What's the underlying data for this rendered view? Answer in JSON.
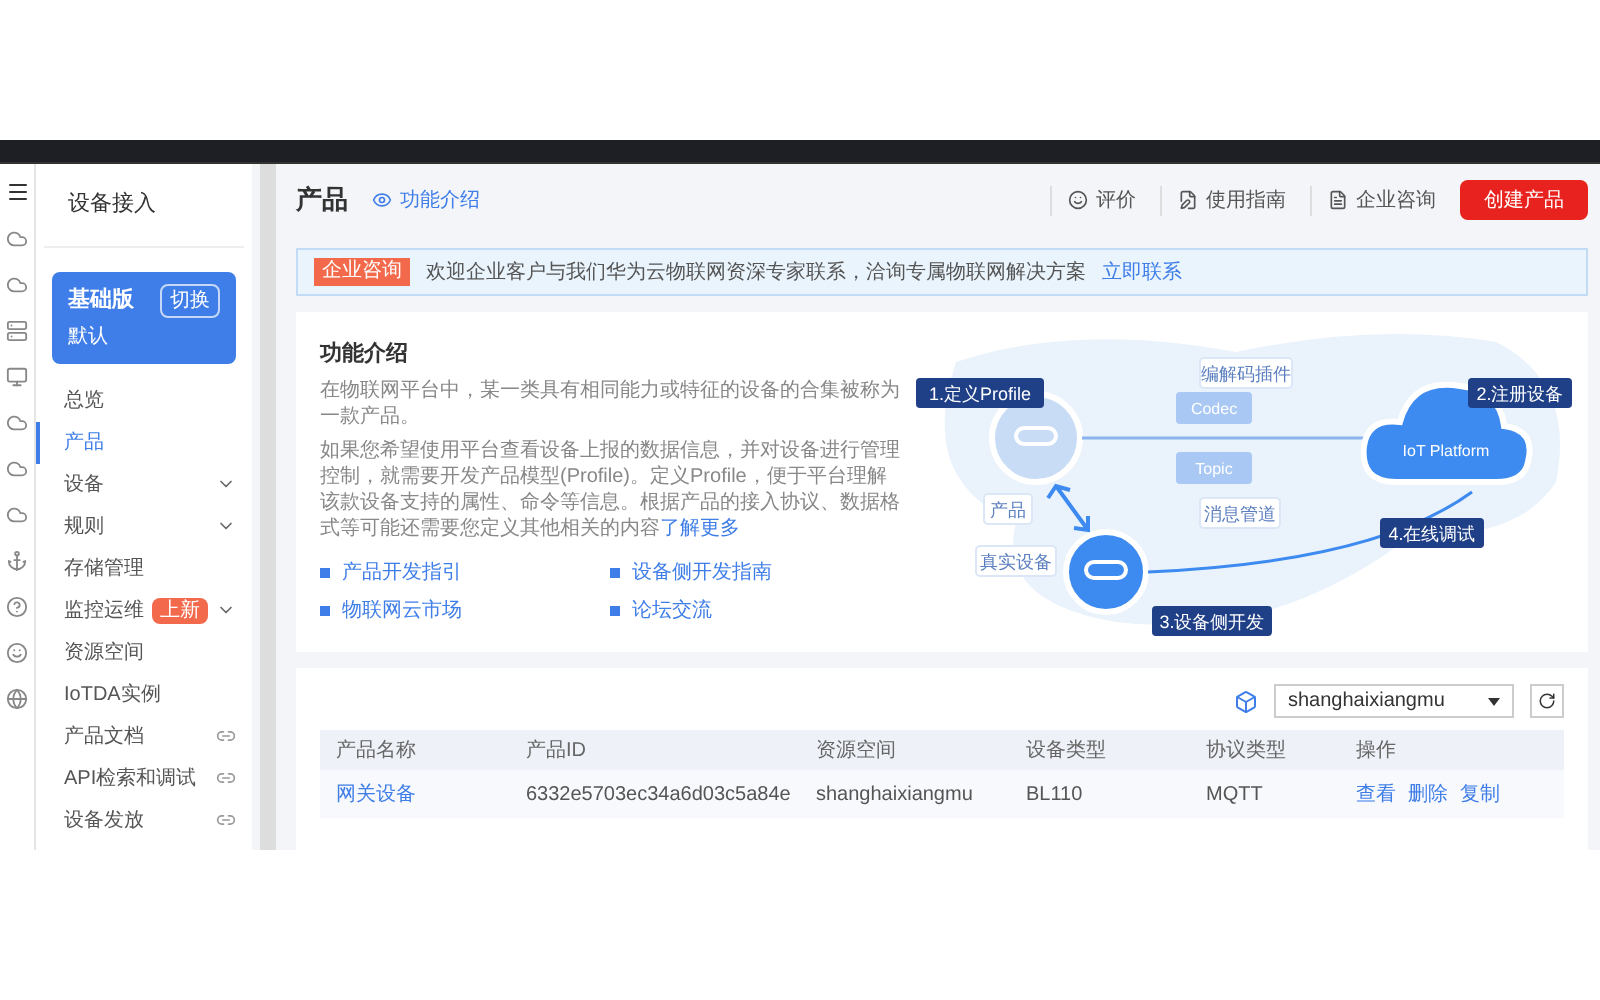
{
  "sidebar": {
    "title": "设备接入",
    "edition": {
      "name": "基础版",
      "switch_label": "切换",
      "subtitle": "默认"
    },
    "items": [
      {
        "label": "总览",
        "selected": false,
        "kind": "plain"
      },
      {
        "label": "产品",
        "selected": true,
        "kind": "plain"
      },
      {
        "label": "设备",
        "selected": false,
        "kind": "expand"
      },
      {
        "label": "规则",
        "selected": false,
        "kind": "expand"
      },
      {
        "label": "存储管理",
        "selected": false,
        "kind": "plain"
      },
      {
        "label": "监控运维",
        "badge": "上新",
        "selected": false,
        "kind": "expand"
      },
      {
        "label": "资源空间",
        "selected": false,
        "kind": "plain"
      },
      {
        "label": "IoTDA实例",
        "selected": false,
        "kind": "plain"
      },
      {
        "label": "产品文档",
        "selected": false,
        "kind": "external"
      },
      {
        "label": "API检索和调试",
        "selected": false,
        "kind": "external"
      },
      {
        "label": "设备发放",
        "selected": false,
        "kind": "external"
      }
    ]
  },
  "page": {
    "title": "产品",
    "intro_link": "功能介绍",
    "actions": [
      "评价",
      "使用指南",
      "企业咨询"
    ],
    "create_button": "创建产品"
  },
  "banner": {
    "tag": "企业咨询",
    "text": "欢迎企业客户与我们华为云物联网资深专家联系，洽询专属物联网解决方案",
    "link": "立即联系"
  },
  "intro": {
    "title": "功能介绍",
    "paragraphs": [
      "在物联网平台中，某一类具有相同能力或特征的设备的合集被称为一款产品。",
      "如果您希望使用平台查看设备上报的数据信息，并对设备进行管理控制，就需要开发产品模型(Profile)。定义Profile，便于平台理解该款设备支持的属性、命令等信息。根据产品的接入协议、数据格式等可能还需要您定义其他相关的内容"
    ],
    "more_link": "了解更多",
    "links": [
      "产品开发指引",
      "设备侧开发指南",
      "物联网云市场",
      "论坛交流"
    ],
    "diagram": {
      "step_1": "1.定义Profile",
      "product": "产品",
      "codec_plugin": "编解码插件",
      "codec": "Codec",
      "topic": "Topic",
      "message_pipe": "消息管道",
      "platform": "IoT Platform",
      "step_2": "2.注册设备",
      "real_device": "真实设备",
      "step_3": "3.设备侧开发",
      "step_4": "4.在线调试"
    }
  },
  "table": {
    "space_select": "shanghaixiangmu",
    "columns": [
      "产品名称",
      "产品ID",
      "资源空间",
      "设备类型",
      "协议类型",
      "操作"
    ],
    "rows": [
      {
        "cells": [
          "网关设备",
          "6332e5703ec34a6d03c5a84e",
          "shanghaixiangmu",
          "BL110",
          "MQTT"
        ],
        "actions": [
          "查看",
          "删除",
          "复制"
        ]
      }
    ]
  }
}
